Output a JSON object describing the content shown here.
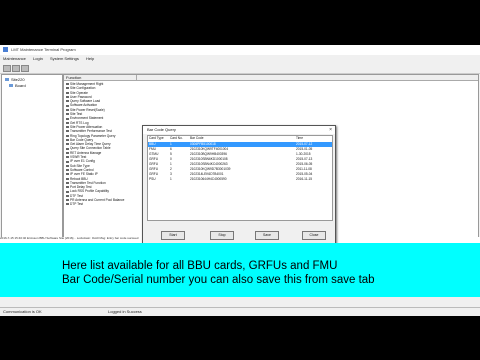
{
  "window": {
    "title": "LMT Maintenance Terminal Program"
  },
  "menu": [
    "Maintenance",
    "Login",
    "System Settings",
    "Help"
  ],
  "tree": [
    {
      "label": "Site220",
      "level": 0
    },
    {
      "label": "Board",
      "level": 1
    }
  ],
  "function_panel": {
    "header": "Function",
    "items": [
      "Site Management Right",
      "Site Configuration",
      "Site Operate",
      "User Password",
      "Query Software Load",
      "Software Activation",
      "Site Power Reset(Scale)",
      "Site Test",
      "Environment Statement",
      "Get RTS Log",
      "Site Power Attenuation",
      "Transmitter Performance Test",
      "Ring Topology Parameter Query",
      "Bar Code Query",
      "Get Alarm Delay Time Query",
      "Query Site Connection Table",
      "RET Antenna Manage",
      "VSWR Test",
      "IP over E1 Config",
      "Sub Site Type",
      "Software Control",
      "IP over FE Static IP",
      "Reboot BBU",
      "Transmitter Test Function",
      "Port Delay Test",
      "Lock RSS Profile Capability",
      "DTF Test",
      "PR Antenna and Current Pool Balance",
      "DTP Test"
    ]
  },
  "log_line": "2016-7-15 15:40:40 Ericsson BBU Software Site [2016]...  Lockdown: 0xA0 Msg: Entry bar code succeed",
  "dialog": {
    "title": "Bar Code Query",
    "columns": [
      "Card Type",
      "Card No.",
      "Bar Code",
      "Time"
    ],
    "rows": [
      {
        "type": "BBU",
        "no": "1",
        "code": "0306PFB5100018",
        "time": "2015-07-12",
        "selected": true
      },
      {
        "type": "FMU",
        "no": "6",
        "code": "2102310KQW9TF4001004",
        "time": "2015-01-05",
        "selected": false
      },
      {
        "type": "GTMU",
        "no": "5",
        "code": "2102310BQW9HB400396",
        "time": "1-30-2015",
        "selected": false
      },
      {
        "type": "GRFU",
        "no": "0",
        "code": "2102310SBN6KD1000108",
        "time": "2015-07-13",
        "selected": false
      },
      {
        "type": "GRFU",
        "no": "1",
        "code": "2102310SBN4KC4000263",
        "time": "2015-06-05",
        "selected": false
      },
      {
        "type": "GRFU",
        "no": "2",
        "code": "2102310KQW9D7B3001039",
        "time": "2011-11-08",
        "selected": false
      },
      {
        "type": "GRFU",
        "no": "3",
        "code": "2102314LEK6D7B4001",
        "time": "2015-05-04",
        "selected": false
      },
      {
        "type": "PSU",
        "no": "1",
        "code": "2102310644H4C4000590",
        "time": "2016-11-15",
        "selected": false
      }
    ],
    "buttons": {
      "start": "Start",
      "stop": "Stop",
      "save": "Save",
      "close": "Close"
    }
  },
  "status": {
    "left": "Communication is OK",
    "mid": "Logged in Success"
  },
  "caption": {
    "line1": "Here list available for all BBU cards, GRFUs and FMU",
    "line2": "Bar Code/Serial number you can also save this from save tab"
  }
}
